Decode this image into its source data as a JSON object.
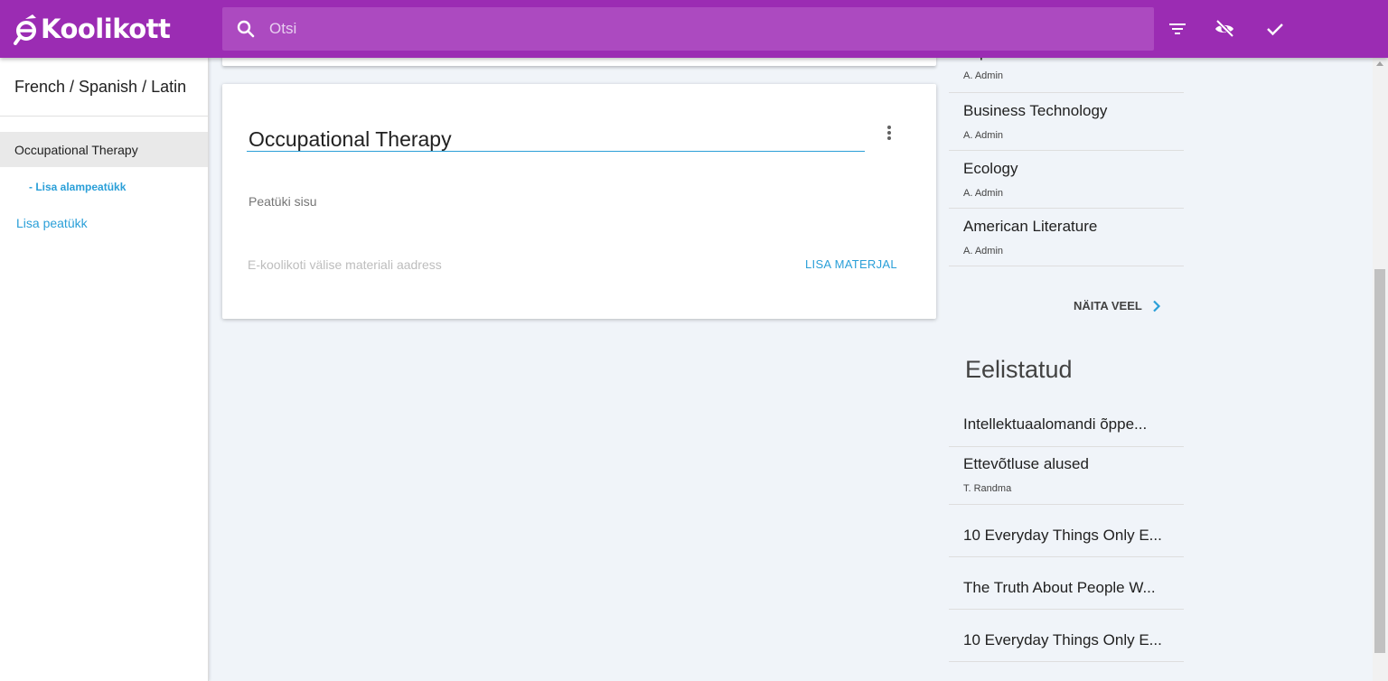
{
  "app": {
    "logo_text": "Koolikott"
  },
  "search": {
    "placeholder": "Otsi"
  },
  "toolbar": {
    "icons": [
      "filter-icon",
      "visibility-off-icon",
      "check-icon"
    ]
  },
  "sidebar": {
    "title": "French / Spanish / Latin",
    "chapter": "Occupational Therapy",
    "add_subchapter": "- Lisa alampeatükk",
    "add_chapter": "Lisa peatükk"
  },
  "chapter_card": {
    "title": "Occupational Therapy",
    "content_placeholder": "Peatüki sisu",
    "url_placeholder": "E-koolikoti välise materiali aadress",
    "add_material": "LISA MATERJAL"
  },
  "recent": {
    "items": [
      {
        "title": "Japanese",
        "author": "A. Admin"
      },
      {
        "title": "Business Technology",
        "author": "A. Admin"
      },
      {
        "title": "Ecology",
        "author": "A. Admin"
      },
      {
        "title": "American Literature",
        "author": "A. Admin"
      }
    ],
    "show_more": "NÄITA VEEL"
  },
  "favorites": {
    "heading": "Eelistatud",
    "items": [
      {
        "title": "Intellektuaalomandi õppe...",
        "author": ""
      },
      {
        "title": "Ettevõtluse alused",
        "author": "T. Randma"
      },
      {
        "title": "10 Everyday Things Only E...",
        "author": ""
      },
      {
        "title": "The Truth About People W...",
        "author": ""
      },
      {
        "title": "10 Everyday Things Only E...",
        "author": ""
      }
    ]
  },
  "colors": {
    "brand": "#9b2cb3",
    "accent": "#2a9fd8",
    "background": "#f0f4f9"
  }
}
